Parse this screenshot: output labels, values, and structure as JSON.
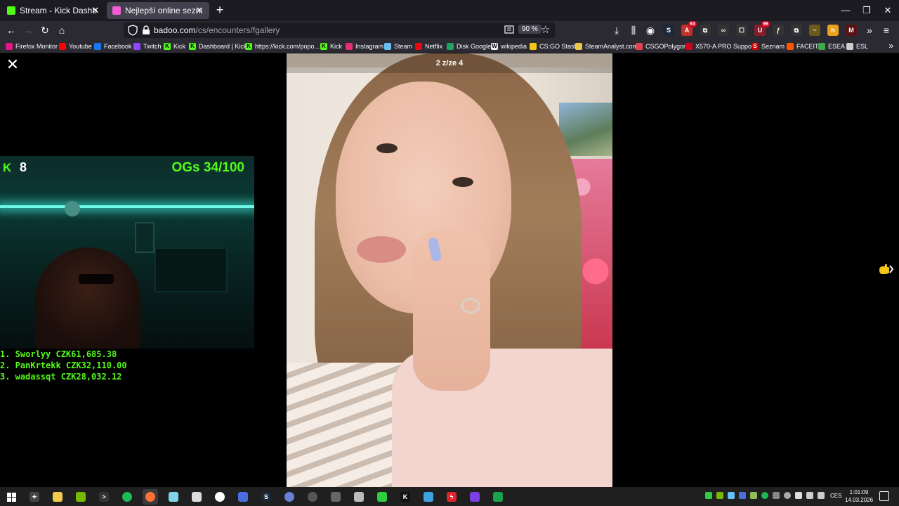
{
  "browser": {
    "tabs": [
      {
        "title": "Stream - Kick Dashboard",
        "favicon": "kick-icon",
        "color": "#53fc18",
        "active": false
      },
      {
        "title": "Nejlepší online seznamka zdarma",
        "favicon": "badoo-icon",
        "color": "#f55cd1",
        "active": true
      }
    ],
    "new_tab_label": "+",
    "window_controls": {
      "minimize": "—",
      "maximize": "❐",
      "close": "✕"
    },
    "url_host": "badoo.com",
    "url_path": "/cs/encounters/fgallery",
    "zoom": "90 %",
    "extension_badges": {
      "adblock": "63",
      "other": "96"
    }
  },
  "bookmarks": [
    {
      "label": "Firefox Monitor",
      "icon": "firefox-monitor-icon",
      "color": "#e31587"
    },
    {
      "label": "Youtube",
      "icon": "youtube-icon",
      "color": "#ff0000"
    },
    {
      "label": "Facebook",
      "icon": "facebook-icon",
      "color": "#1877f2"
    },
    {
      "label": "Twitch",
      "icon": "twitch-icon",
      "color": "#9146ff"
    },
    {
      "label": "Kick",
      "icon": "kick-icon",
      "color": "#53fc18"
    },
    {
      "label": "Dashboard | Kick",
      "icon": "kick-icon",
      "color": "#53fc18"
    },
    {
      "label": "https://kick.com/popo...",
      "icon": "kick-icon",
      "color": "#53fc18"
    },
    {
      "label": "Kick",
      "icon": "kick-icon",
      "color": "#53fc18"
    },
    {
      "label": "Instagram",
      "icon": "instagram-icon",
      "color": "#e1306c"
    },
    {
      "label": "Steam",
      "icon": "steam-icon",
      "color": "#66c0f4"
    },
    {
      "label": "Netflix",
      "icon": "netflix-icon",
      "color": "#e50914"
    },
    {
      "label": "Disk Google",
      "icon": "google-drive-icon",
      "color": "#1fa463"
    },
    {
      "label": "wikipedia",
      "icon": "wikipedia-icon",
      "color": "#dddddd"
    },
    {
      "label": "CS:GO Stash",
      "icon": "csgo-stash-icon",
      "color": "#f5c518"
    },
    {
      "label": "SteamAnalyst.com",
      "icon": "steamanalyst-icon",
      "color": "#e9c84a"
    },
    {
      "label": "CSGOPolygon",
      "icon": "csgopolygon-icon",
      "color": "#e2444f"
    },
    {
      "label": "X570-A PRO Support",
      "icon": "msi-icon",
      "color": "#d0021b"
    },
    {
      "label": "Seznam",
      "icon": "seznam-icon",
      "color": "#cc0000"
    },
    {
      "label": "FACEIT",
      "icon": "faceit-icon",
      "color": "#ff5500"
    },
    {
      "label": "ESEA",
      "icon": "esea-icon",
      "color": "#3fa84a"
    },
    {
      "label": "ESL",
      "icon": "esl-icon",
      "color": "#cccccc"
    }
  ],
  "gallery": {
    "counter": "2 z/ze 4",
    "close_icon": "close-icon",
    "next_icon": "chevron-right-icon"
  },
  "stream_overlay": {
    "kick_logo": "K",
    "viewer_count": "8",
    "ogs": "OGs 34/100",
    "accent_color": "#53fc18",
    "leaderboard": [
      "1. Sworlyy CZK61,685.38",
      "2. PanKrtekk CZK32,110.00",
      "3. wadassqt CZK28,032.12"
    ]
  },
  "taskbar": {
    "language": "CES",
    "time": "1:01:09",
    "date": "14.03.2026"
  }
}
